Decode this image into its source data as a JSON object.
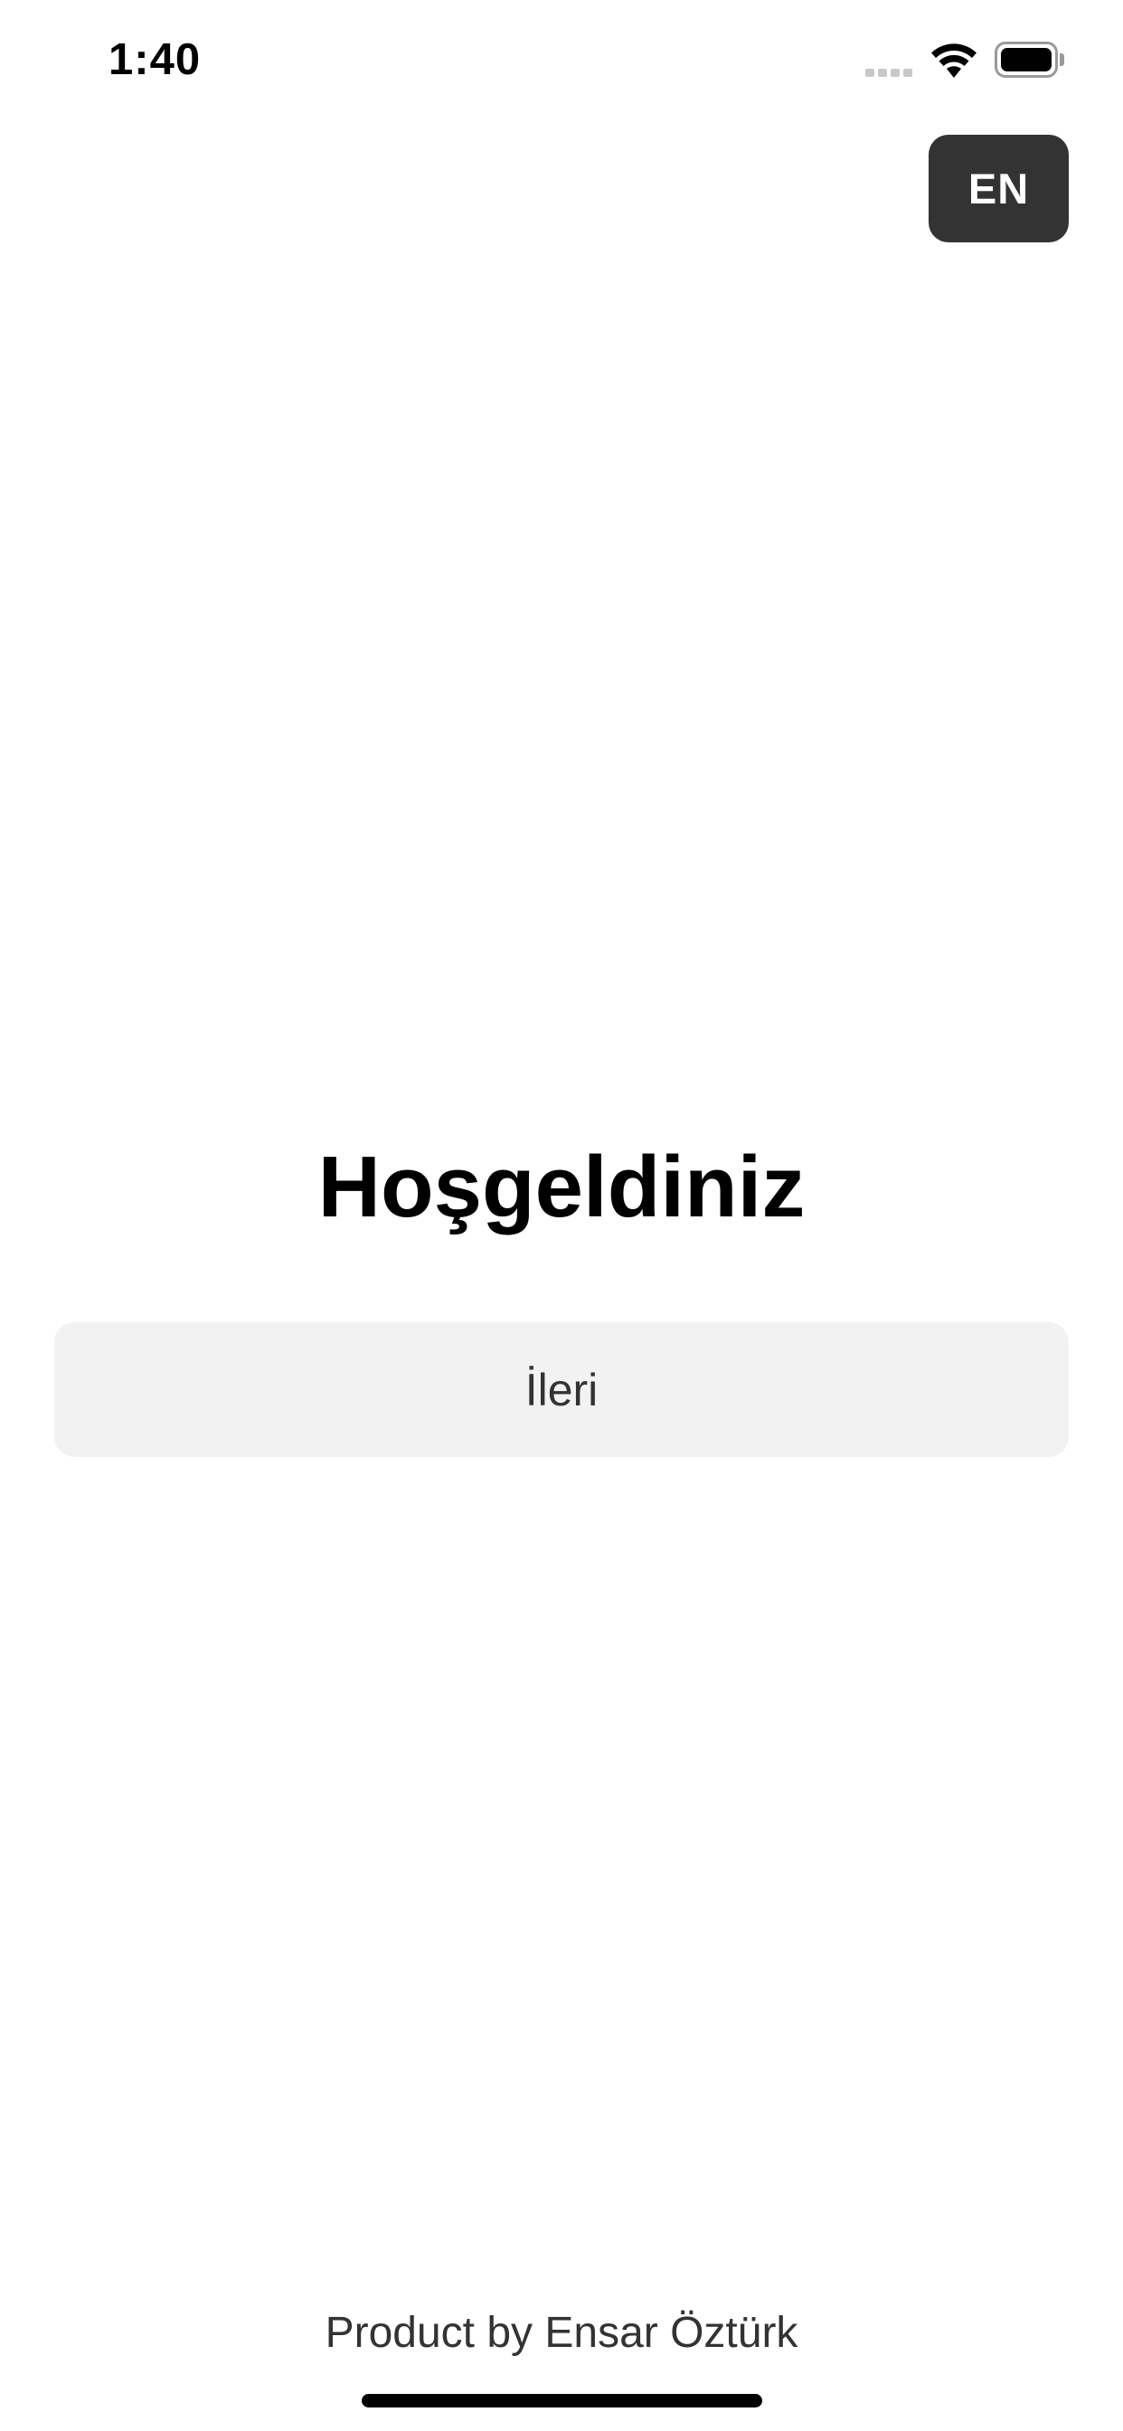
{
  "status_bar": {
    "time": "1:40",
    "signal_icon": "cellular-signal-icon",
    "wifi_icon": "wifi-icon",
    "battery_icon": "battery-icon"
  },
  "language_toggle": {
    "label": "EN"
  },
  "welcome": {
    "title": "Hoşgeldiniz",
    "next_label": "İleri"
  },
  "footer": {
    "credit": "Product by Ensar Öztürk"
  },
  "colors": {
    "language_button_bg": "#333333",
    "next_button_bg": "#f2f2f2",
    "secondary_text": "#333333"
  }
}
